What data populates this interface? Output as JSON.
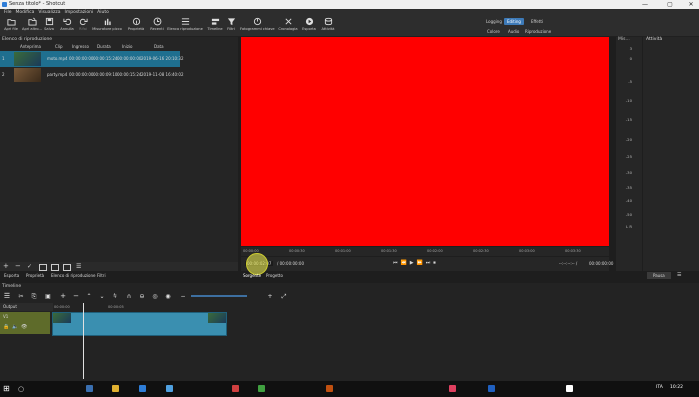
{
  "window": {
    "title": "Senza titolo* - Shotcut",
    "min": "—",
    "max": "▢",
    "close": "✕"
  },
  "menu": [
    "File",
    "Modifica",
    "Visualizza",
    "Impostazioni",
    "Aiuto"
  ],
  "toolbar": {
    "buttons": [
      {
        "label": "Apri file",
        "icon": "folder-open-icon"
      },
      {
        "label": "Apri altro...",
        "icon": "open-other-icon"
      },
      {
        "label": "Salva",
        "icon": "save-icon"
      },
      {
        "label": "Annulla",
        "icon": "undo-icon"
      },
      {
        "label": "Rifai",
        "icon": "redo-icon"
      },
      {
        "label": "Misuratore picco",
        "icon": "peak-meter-icon"
      },
      {
        "label": "Proprietà",
        "icon": "properties-icon"
      },
      {
        "label": "Recenti",
        "icon": "recent-icon"
      },
      {
        "label": "Elenco riproduzione",
        "icon": "playlist-icon"
      },
      {
        "label": "Timeline",
        "icon": "timeline-icon"
      },
      {
        "label": "Filtri",
        "icon": "filter-icon"
      },
      {
        "label": "Fotogrammi chiave",
        "icon": "keyframes-icon"
      },
      {
        "label": "Cronologia",
        "icon": "history-icon"
      },
      {
        "label": "Esporta",
        "icon": "export-icon"
      },
      {
        "label": "Attività",
        "icon": "jobs-icon"
      }
    ],
    "layouts_top": [
      "Logging",
      "Editing",
      "Effetti"
    ],
    "layouts_active": "Editing",
    "layouts_bottom": [
      "Colore",
      "Audio",
      "Riproduzione"
    ]
  },
  "playlist": {
    "title": "Elenco di riproduzione",
    "columns": [
      "Anteprima",
      "Clip",
      "Ingresso",
      "Durata",
      "Inizio",
      "Data"
    ],
    "rows": [
      {
        "num": "1",
        "clip": "moto.mp4",
        "in": "00:00:00:00",
        "dur": "00:00:15:24",
        "start": "00:00:00:00",
        "date": "2019-06-16 20:10:32",
        "selected": true
      },
      {
        "num": "2",
        "clip": "party.mp4",
        "in": "00:00:00:00",
        "dur": "00:00:09:10",
        "start": "00:00:15:24",
        "date": "2019-11-08 16:40:02",
        "selected": false
      }
    ],
    "bottom_tabs": [
      "Esporta",
      "Proprietà",
      "Elenco di riproduzione",
      "Filtri"
    ]
  },
  "preview": {
    "ruler_ticks": [
      "00:00:00",
      "00:00:30",
      "00:01:00",
      "00:01:30",
      "00:02:00",
      "00:02:30",
      "00:03:00",
      "00:03:30"
    ],
    "position": "00:00:02:07",
    "duration": "/ 00:00:00:00",
    "in_point": "--:--:--:-- /",
    "out_point": "00:00:00:00",
    "tabs": [
      "Sorgente",
      "Progetto"
    ],
    "frame_color": "#ff0000"
  },
  "meter": {
    "title": "Mis...",
    "levels": [
      "3",
      "0",
      "-5",
      "-10",
      "-15",
      "-20",
      "-25",
      "-30",
      "-35",
      "-40",
      "-50"
    ],
    "channels": "L R"
  },
  "jobs": {
    "title": "Attività",
    "pause_label": "Pausa"
  },
  "timeline": {
    "title": "Timeline",
    "ticks": [
      "00:00:00",
      "00:00:05"
    ],
    "output_label": "Output",
    "track_name": "V1",
    "clip_color": "#3a8fb0"
  },
  "taskbar": {
    "lang": "ITA",
    "time": "10:22"
  }
}
